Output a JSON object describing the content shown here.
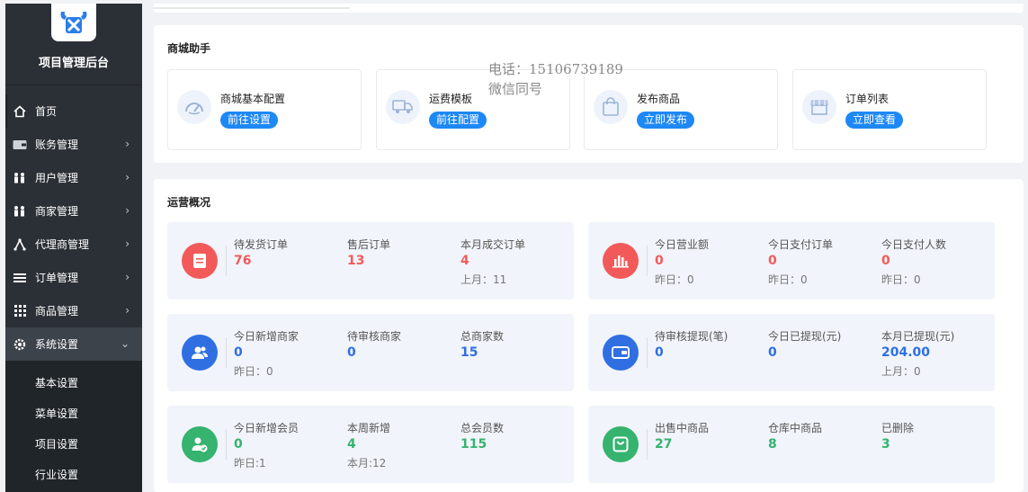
{
  "sidebar": {
    "brand_title": "项目管理后台",
    "items": [
      {
        "label": "首页",
        "icon": "home-icon"
      },
      {
        "label": "账务管理",
        "icon": "wallet-icon"
      },
      {
        "label": "用户管理",
        "icon": "users-icon"
      },
      {
        "label": "商家管理",
        "icon": "users-icon"
      },
      {
        "label": "代理商管理",
        "icon": "network-icon"
      },
      {
        "label": "订单管理",
        "icon": "list-icon"
      },
      {
        "label": "商品管理",
        "icon": "grid-icon"
      },
      {
        "label": "系统设置",
        "icon": "gear-icon"
      }
    ],
    "sub_items": [
      "基本设置",
      "菜单设置",
      "项目设置",
      "行业设置"
    ]
  },
  "helper": {
    "title": "商城助手",
    "items": [
      {
        "label": "商城基本配置",
        "button": "前往设置",
        "icon": "speedometer-icon"
      },
      {
        "label": "运费模板",
        "button": "前往配置",
        "icon": "truck-icon"
      },
      {
        "label": "发布商品",
        "button": "立即发布",
        "icon": "bag-icon"
      },
      {
        "label": "订单列表",
        "button": "立即查看",
        "icon": "store-icon"
      }
    ]
  },
  "watermark": {
    "line1": "电话：15106739189",
    "line2": "微信同号"
  },
  "overview": {
    "title": "运营概况",
    "panels": [
      {
        "icon": "document-icon",
        "icon_color": "#f25a5a",
        "value_color": "red",
        "stats": [
          {
            "label": "待发货订单",
            "value": "76",
            "sub": ""
          },
          {
            "label": "售后订单",
            "value": "13",
            "sub": ""
          },
          {
            "label": "本月成交订单",
            "value": "4",
            "sub": "上月：11"
          }
        ]
      },
      {
        "icon": "bar-chart-icon",
        "icon_color": "#f25a5a",
        "value_color": "red",
        "stats": [
          {
            "label": "今日营业额",
            "value": "0",
            "sub": "昨日：0"
          },
          {
            "label": "今日支付订单",
            "value": "0",
            "sub": "昨日：0"
          },
          {
            "label": "今日支付人数",
            "value": "0",
            "sub": "昨日：0"
          }
        ]
      },
      {
        "icon": "merchants-icon",
        "icon_color": "#2f6fe2",
        "value_color": "blue",
        "stats": [
          {
            "label": "今日新增商家",
            "value": "0",
            "sub": "昨日：0"
          },
          {
            "label": "待审核商家",
            "value": "0",
            "sub": ""
          },
          {
            "label": "总商家数",
            "value": "15",
            "sub": ""
          }
        ]
      },
      {
        "icon": "wallet-icon",
        "icon_color": "#2f6fe2",
        "value_color": "blue",
        "stats": [
          {
            "label": "待审核提现(笔)",
            "value": "0",
            "sub": ""
          },
          {
            "label": "今日已提现(元)",
            "value": "0",
            "sub": ""
          },
          {
            "label": "本月已提现(元)",
            "value": "204.00",
            "sub": "上月：0"
          }
        ]
      },
      {
        "icon": "member-icon",
        "icon_color": "#35b36f",
        "value_color": "green",
        "stats": [
          {
            "label": "今日新增会员",
            "value": "0",
            "sub": "昨日:1"
          },
          {
            "label": "本周新增",
            "value": "4",
            "sub": "本月:12"
          },
          {
            "label": "总会员数",
            "value": "115",
            "sub": ""
          }
        ]
      },
      {
        "icon": "shopping-bag-icon",
        "icon_color": "#35b36f",
        "value_color": "green",
        "stats": [
          {
            "label": "出售中商品",
            "value": "27",
            "sub": ""
          },
          {
            "label": "仓库中商品",
            "value": "8",
            "sub": ""
          },
          {
            "label": "已删除",
            "value": "3",
            "sub": ""
          }
        ]
      }
    ]
  }
}
